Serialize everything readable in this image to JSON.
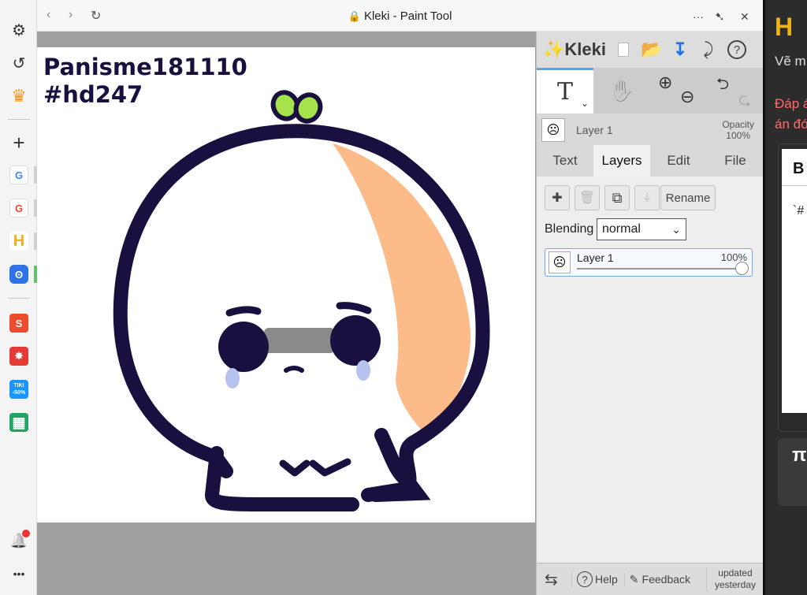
{
  "browser": {
    "title": "Kleki - Paint Tool",
    "ellipsis": "···",
    "close": "✕"
  },
  "sidebar": {
    "items": [
      {
        "name": "settings",
        "glyph": "⚙"
      },
      {
        "name": "history",
        "glyph": "↺"
      },
      {
        "name": "crown",
        "glyph": "♛"
      },
      {
        "name": "add",
        "glyph": "+"
      },
      {
        "name": "google-1",
        "glyph": "G"
      },
      {
        "name": "google-2",
        "glyph": "G"
      },
      {
        "name": "h-app",
        "glyph": "H"
      },
      {
        "name": "kleki",
        "glyph": "ʘ"
      },
      {
        "name": "shopee",
        "glyph": "S"
      },
      {
        "name": "app-red",
        "glyph": "✸"
      },
      {
        "name": "tiki",
        "text1": "TIKI",
        "text2": "-50%"
      },
      {
        "name": "sheets",
        "glyph": "▦"
      }
    ],
    "bell": "🔔",
    "more": "•••"
  },
  "canvas": {
    "text_line1": "Panisme181110",
    "text_line2": "#hd247"
  },
  "kleki": {
    "logo": "Kleki",
    "tools": {
      "text_tool": "T",
      "hand_tool": "✋",
      "zoom_in": "⊕",
      "zoom_out": "⊖",
      "undo": "⮌",
      "redo": "⮎"
    },
    "active_layer": "Layer 1",
    "opacity_label": "Opacity",
    "opacity_value": "100%",
    "tabs": [
      "Text",
      "Layers",
      "Edit",
      "File"
    ],
    "active_tab": "Layers",
    "layer_buttons": {
      "add": "✚",
      "delete": "🗑",
      "duplicate": "⧉",
      "merge": "⤓",
      "rename": "Rename"
    },
    "blending_label": "Blending",
    "blending_value": "normal",
    "layers": [
      {
        "name": "Layer 1",
        "opacity": "100%",
        "opacity_fraction": 1.0
      }
    ],
    "footer": {
      "swap": "⇆",
      "help": "Help",
      "feedback": "Feedback",
      "updated_line1": "updated",
      "updated_line2": "yesterday"
    }
  },
  "right_window": {
    "text1": "Vẽ m",
    "text2": "Đáp á",
    "text3": "án đó",
    "text4": "B",
    "text5": "`#",
    "text6": "π"
  },
  "colors": {
    "accent": "#6b9fd4",
    "outline": "#1a1040",
    "peach": "#fdbb8a",
    "tear": "#b7c3ef",
    "leaf": "#a6e34a"
  }
}
